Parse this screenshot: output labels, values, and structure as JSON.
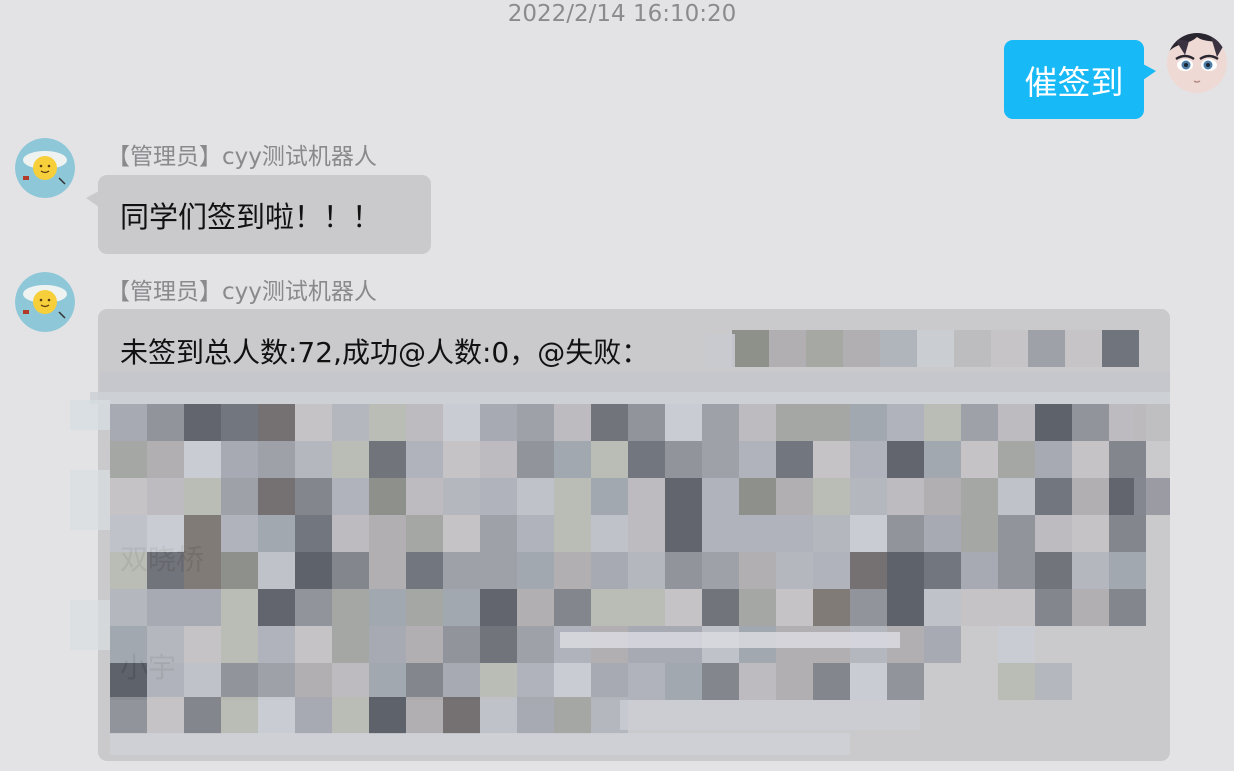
{
  "conversation": {
    "timestamp": "2022/2/14 16:10:20",
    "outgoing": {
      "text": "催签到"
    },
    "incoming": [
      {
        "sender": "【管理员】cyy测试机器人",
        "text": "同学们签到啦！！！"
      },
      {
        "sender": "【管理员】cyy测试机器人",
        "text": "未签到总人数:72,成功@人数:0，@失败：",
        "partial_lines": [
          "双晓桥",
          "小宇"
        ]
      }
    ]
  },
  "colors": {
    "background": "#e3e3e6",
    "outgoing_bubble": "#18b9f7",
    "incoming_bubble": "#cacacd",
    "sender_name": "#8a8a8d",
    "timestamp": "#8b8b8e"
  },
  "icons": {
    "user_avatar": "anime-face-avatar",
    "bot_avatar": "sun-cartoon-avatar"
  }
}
